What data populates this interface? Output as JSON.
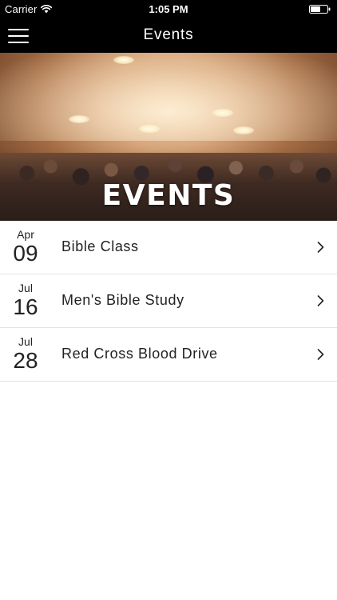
{
  "status_bar": {
    "carrier": "Carrier",
    "time": "1:05 PM",
    "icons": [
      "wifi-icon",
      "battery-icon"
    ]
  },
  "nav": {
    "title": "Events",
    "menu_icon": "hamburger-menu-icon"
  },
  "hero": {
    "banner_text": "EVENTS"
  },
  "events": [
    {
      "month": "Apr",
      "day": "09",
      "title": "Bible Class"
    },
    {
      "month": "Jul",
      "day": "16",
      "title": "Men's Bible Study"
    },
    {
      "month": "Jul",
      "day": "28",
      "title": "Red Cross Blood Drive"
    }
  ],
  "colors": {
    "bar_background": "#000000",
    "bar_text": "#ffffff",
    "list_text": "#222222",
    "divider": "#e2e2e2"
  }
}
